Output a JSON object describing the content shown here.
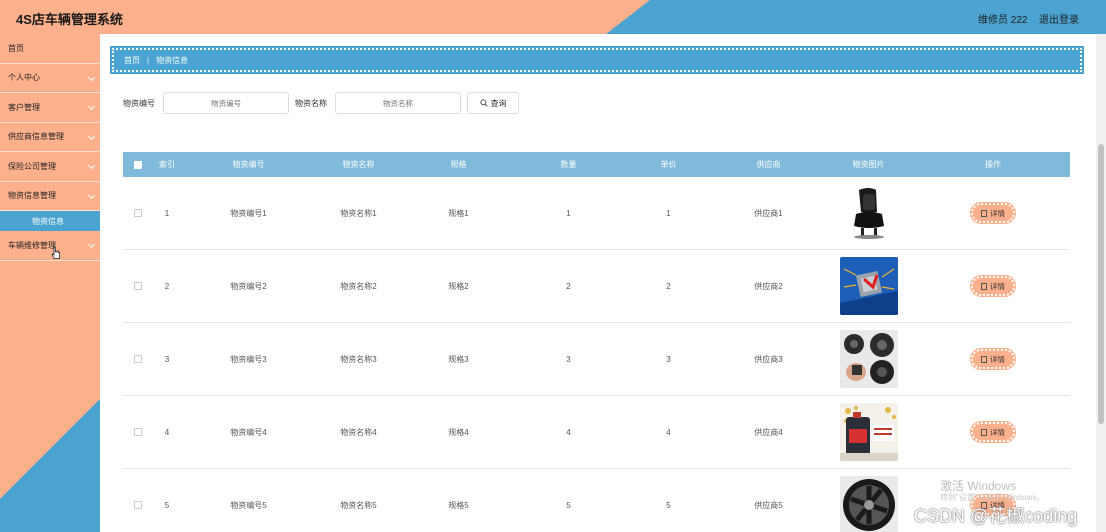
{
  "header": {
    "title": "4S店车辆管理系统",
    "user_label": "维修员 222",
    "logout_label": "退出登录"
  },
  "sidebar": {
    "items": [
      {
        "label": "首页",
        "has_chevron": false
      },
      {
        "label": "个人中心",
        "has_chevron": true
      },
      {
        "label": "客户管理",
        "has_chevron": true
      },
      {
        "label": "供应商信息管理",
        "has_chevron": true
      },
      {
        "label": "保险公司管理",
        "has_chevron": true
      },
      {
        "label": "物资信息管理",
        "has_chevron": true
      }
    ],
    "submenu": {
      "label": "物资信息"
    },
    "last_item": {
      "label": "车辆维修管理"
    }
  },
  "breadcrumb": {
    "home": "首页",
    "separator": "|",
    "current": "物资信息"
  },
  "search": {
    "code_label": "物资编号",
    "code_placeholder": "物资编号",
    "name_label": "物资名称",
    "name_placeholder": "物资名称",
    "query_label": "查询"
  },
  "table": {
    "headers": [
      "索引",
      "物资编号",
      "物资名称",
      "规格",
      "数量",
      "单价",
      "供应商",
      "物资图片",
      "操作"
    ],
    "detail_label": "详情",
    "rows": [
      {
        "index": "1",
        "code": "物资编号1",
        "name": "物资名称1",
        "spec": "规格1",
        "qty": "1",
        "price": "1",
        "supplier": "供应商1",
        "image": "car-seat"
      },
      {
        "index": "2",
        "code": "物资编号2",
        "name": "物资名称2",
        "spec": "规格2",
        "qty": "2",
        "price": "2",
        "supplier": "供应商2",
        "image": "circuit-chip"
      },
      {
        "index": "3",
        "code": "物资编号3",
        "name": "物资名称3",
        "spec": "规格3",
        "qty": "3",
        "price": "3",
        "supplier": "供应商3",
        "image": "speakers"
      },
      {
        "index": "4",
        "code": "物资编号4",
        "name": "物资名称4",
        "spec": "规格4",
        "qty": "4",
        "price": "4",
        "supplier": "供应商4",
        "image": "oil-bottle"
      },
      {
        "index": "5",
        "code": "物资编号5",
        "name": "物资名称5",
        "spec": "规格5",
        "qty": "5",
        "price": "5",
        "supplier": "供应商5",
        "image": "wheel-rim"
      }
    ]
  },
  "watermark": {
    "line1": "激活 Windows",
    "line2": "转到\"设置\"以激活 Windows。",
    "csdn": "CSDN @花椒coding"
  },
  "colors": {
    "peach": "#fdb08c",
    "blue": "#4aa3d0",
    "table_header": "#7fbadb"
  }
}
